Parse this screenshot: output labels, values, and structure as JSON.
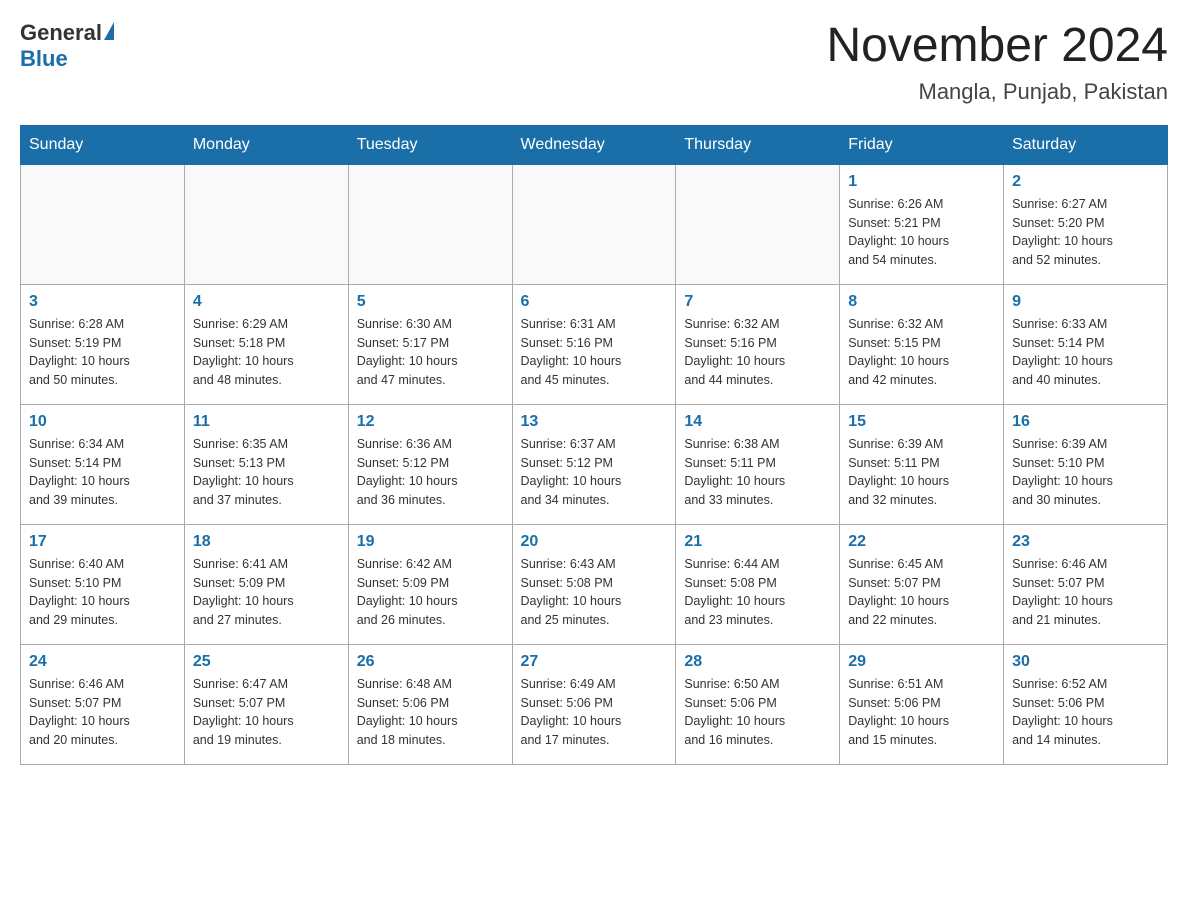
{
  "header": {
    "logo_general": "General",
    "logo_blue": "Blue",
    "month_title": "November 2024",
    "location": "Mangla, Punjab, Pakistan"
  },
  "weekdays": [
    "Sunday",
    "Monday",
    "Tuesday",
    "Wednesday",
    "Thursday",
    "Friday",
    "Saturday"
  ],
  "weeks": [
    [
      {
        "day": "",
        "info": ""
      },
      {
        "day": "",
        "info": ""
      },
      {
        "day": "",
        "info": ""
      },
      {
        "day": "",
        "info": ""
      },
      {
        "day": "",
        "info": ""
      },
      {
        "day": "1",
        "info": "Sunrise: 6:26 AM\nSunset: 5:21 PM\nDaylight: 10 hours\nand 54 minutes."
      },
      {
        "day": "2",
        "info": "Sunrise: 6:27 AM\nSunset: 5:20 PM\nDaylight: 10 hours\nand 52 minutes."
      }
    ],
    [
      {
        "day": "3",
        "info": "Sunrise: 6:28 AM\nSunset: 5:19 PM\nDaylight: 10 hours\nand 50 minutes."
      },
      {
        "day": "4",
        "info": "Sunrise: 6:29 AM\nSunset: 5:18 PM\nDaylight: 10 hours\nand 48 minutes."
      },
      {
        "day": "5",
        "info": "Sunrise: 6:30 AM\nSunset: 5:17 PM\nDaylight: 10 hours\nand 47 minutes."
      },
      {
        "day": "6",
        "info": "Sunrise: 6:31 AM\nSunset: 5:16 PM\nDaylight: 10 hours\nand 45 minutes."
      },
      {
        "day": "7",
        "info": "Sunrise: 6:32 AM\nSunset: 5:16 PM\nDaylight: 10 hours\nand 44 minutes."
      },
      {
        "day": "8",
        "info": "Sunrise: 6:32 AM\nSunset: 5:15 PM\nDaylight: 10 hours\nand 42 minutes."
      },
      {
        "day": "9",
        "info": "Sunrise: 6:33 AM\nSunset: 5:14 PM\nDaylight: 10 hours\nand 40 minutes."
      }
    ],
    [
      {
        "day": "10",
        "info": "Sunrise: 6:34 AM\nSunset: 5:14 PM\nDaylight: 10 hours\nand 39 minutes."
      },
      {
        "day": "11",
        "info": "Sunrise: 6:35 AM\nSunset: 5:13 PM\nDaylight: 10 hours\nand 37 minutes."
      },
      {
        "day": "12",
        "info": "Sunrise: 6:36 AM\nSunset: 5:12 PM\nDaylight: 10 hours\nand 36 minutes."
      },
      {
        "day": "13",
        "info": "Sunrise: 6:37 AM\nSunset: 5:12 PM\nDaylight: 10 hours\nand 34 minutes."
      },
      {
        "day": "14",
        "info": "Sunrise: 6:38 AM\nSunset: 5:11 PM\nDaylight: 10 hours\nand 33 minutes."
      },
      {
        "day": "15",
        "info": "Sunrise: 6:39 AM\nSunset: 5:11 PM\nDaylight: 10 hours\nand 32 minutes."
      },
      {
        "day": "16",
        "info": "Sunrise: 6:39 AM\nSunset: 5:10 PM\nDaylight: 10 hours\nand 30 minutes."
      }
    ],
    [
      {
        "day": "17",
        "info": "Sunrise: 6:40 AM\nSunset: 5:10 PM\nDaylight: 10 hours\nand 29 minutes."
      },
      {
        "day": "18",
        "info": "Sunrise: 6:41 AM\nSunset: 5:09 PM\nDaylight: 10 hours\nand 27 minutes."
      },
      {
        "day": "19",
        "info": "Sunrise: 6:42 AM\nSunset: 5:09 PM\nDaylight: 10 hours\nand 26 minutes."
      },
      {
        "day": "20",
        "info": "Sunrise: 6:43 AM\nSunset: 5:08 PM\nDaylight: 10 hours\nand 25 minutes."
      },
      {
        "day": "21",
        "info": "Sunrise: 6:44 AM\nSunset: 5:08 PM\nDaylight: 10 hours\nand 23 minutes."
      },
      {
        "day": "22",
        "info": "Sunrise: 6:45 AM\nSunset: 5:07 PM\nDaylight: 10 hours\nand 22 minutes."
      },
      {
        "day": "23",
        "info": "Sunrise: 6:46 AM\nSunset: 5:07 PM\nDaylight: 10 hours\nand 21 minutes."
      }
    ],
    [
      {
        "day": "24",
        "info": "Sunrise: 6:46 AM\nSunset: 5:07 PM\nDaylight: 10 hours\nand 20 minutes."
      },
      {
        "day": "25",
        "info": "Sunrise: 6:47 AM\nSunset: 5:07 PM\nDaylight: 10 hours\nand 19 minutes."
      },
      {
        "day": "26",
        "info": "Sunrise: 6:48 AM\nSunset: 5:06 PM\nDaylight: 10 hours\nand 18 minutes."
      },
      {
        "day": "27",
        "info": "Sunrise: 6:49 AM\nSunset: 5:06 PM\nDaylight: 10 hours\nand 17 minutes."
      },
      {
        "day": "28",
        "info": "Sunrise: 6:50 AM\nSunset: 5:06 PM\nDaylight: 10 hours\nand 16 minutes."
      },
      {
        "day": "29",
        "info": "Sunrise: 6:51 AM\nSunset: 5:06 PM\nDaylight: 10 hours\nand 15 minutes."
      },
      {
        "day": "30",
        "info": "Sunrise: 6:52 AM\nSunset: 5:06 PM\nDaylight: 10 hours\nand 14 minutes."
      }
    ]
  ]
}
